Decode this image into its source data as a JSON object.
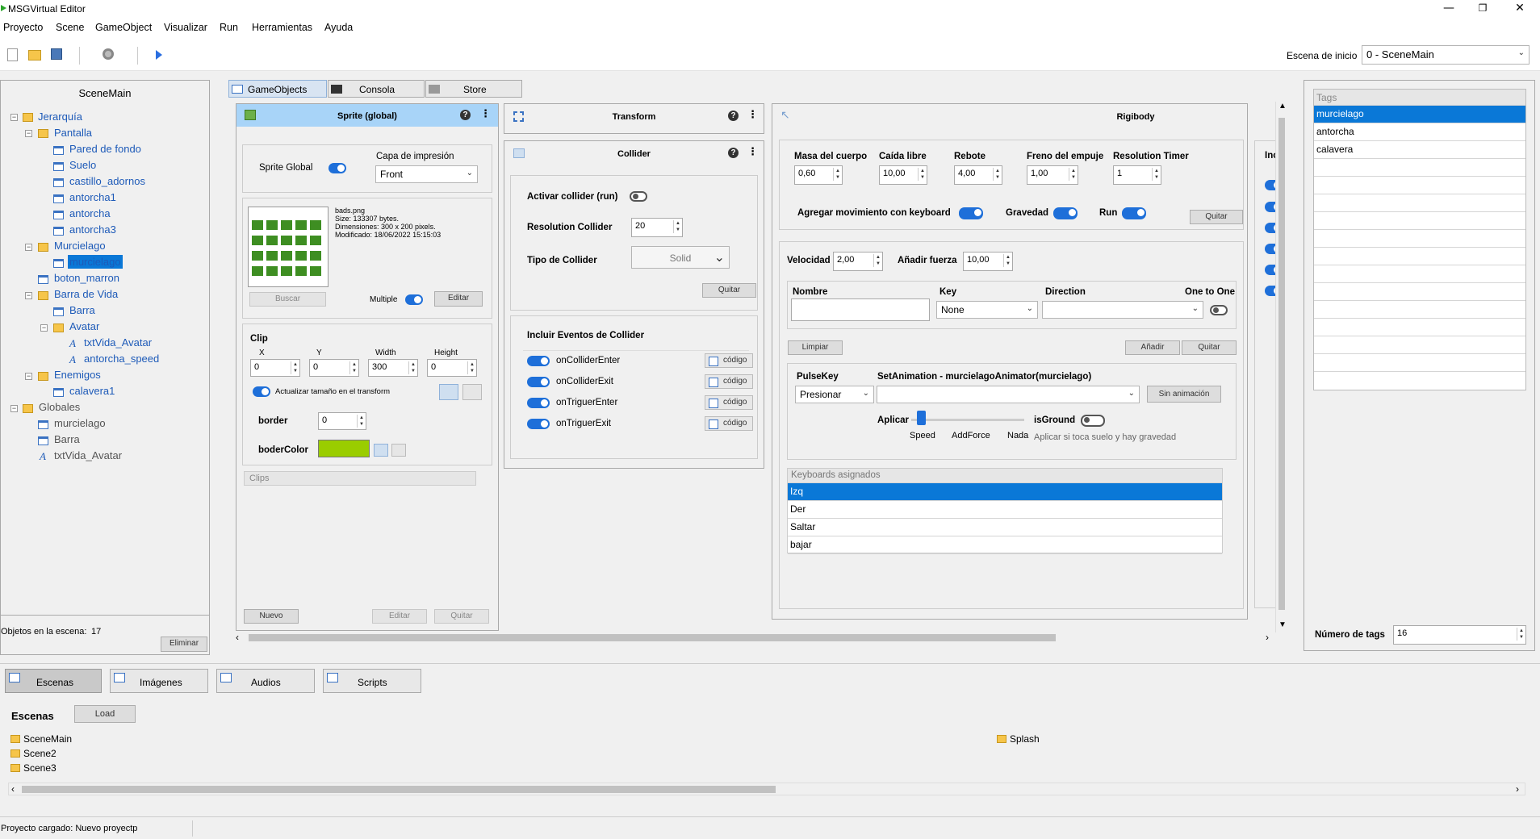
{
  "window": {
    "title": "MSGVirtual Editor",
    "minimize": "—",
    "maximize": "❐",
    "close": "✕"
  },
  "menu": [
    "Proyecto",
    "Scene",
    "GameObject",
    "Visualizar",
    "Run",
    "Herramientas",
    "Ayuda"
  ],
  "toolbar": {
    "start_scene_label": "Escena de inicio",
    "start_scene_value": "0 - SceneMain"
  },
  "hierarchy": {
    "title": "SceneMain",
    "nodes": [
      "Jerarquía",
      "Pantalla",
      "Pared de fondo",
      "Suelo",
      "castillo_adornos",
      "antorcha1",
      "antorcha",
      "antorcha3",
      "Murcielago",
      "murcielago",
      "boton_marron",
      "Barra de Vida",
      "Barra",
      "Avatar",
      "txtVida_Avatar",
      "antorcha_speed",
      "Enemigos",
      "calavera1",
      "Globales",
      "murcielago",
      "Barra",
      "txtVida_Avatar"
    ],
    "count_label": "Objetos en la escena:",
    "count": "17",
    "delete_button": "Eliminar"
  },
  "inspector_tabs": [
    "GameObjects",
    "Consola",
    "Store"
  ],
  "sprite": {
    "title": "Sprite (global)",
    "global_label": "Sprite Global",
    "layer_label": "Capa de impresión",
    "layer_value": "Front",
    "file_name": "bads.png",
    "file_size": "Size: 133307 bytes.",
    "file_dims": "Dimensiones: 300 x 200 pixels.",
    "file_modified": "Modificado: 18/06/2022 15:15:03",
    "search_button": "Buscar",
    "multiple_label": "Multiple",
    "edit_button": "Editar",
    "clip_label": "Clip",
    "clip_fields": [
      {
        "label": "X",
        "value": "0"
      },
      {
        "label": "Y",
        "value": "0"
      },
      {
        "label": "Width",
        "value": "300"
      },
      {
        "label": "Height",
        "value": "0"
      }
    ],
    "update_size_label": "Actualizar tamaño en el transform",
    "border_label": "border",
    "border_value": "0",
    "border_color_label": "boderColor",
    "border_color": "#9acd00",
    "clips_label": "Clips",
    "new_button": "Nuevo",
    "edit2_button": "Editar",
    "remove_button": "Quitar"
  },
  "transform": {
    "title": "Transform"
  },
  "collider": {
    "title": "Collider",
    "activate_label": "Activar collider (run)",
    "resolution_label": "Resolution Collider",
    "resolution_value": "20",
    "type_label": "Tipo de Collider",
    "type_value": "Solid",
    "remove_button": "Quitar",
    "events_title": "Incluir Eventos de Collider",
    "events": [
      "onColliderEnter",
      "onColliderExit",
      "onTriguerEnter",
      "onTriguerExit"
    ],
    "code_button": "código"
  },
  "rigidbody": {
    "title": "Rigibody",
    "fields": [
      {
        "label": "Masa del cuerpo",
        "value": "0,60"
      },
      {
        "label": "Caída libre",
        "value": "10,00"
      },
      {
        "label": "Rebote",
        "value": "4,00"
      },
      {
        "label": "Freno del empuje",
        "value": "1,00"
      },
      {
        "label": "Resolution Timer",
        "value": "1"
      }
    ],
    "keyboard_move_label": "Agregar movimiento con keyboard",
    "gravity_label": "Gravedad",
    "run_label": "Run",
    "remove_button": "Quitar",
    "speed_label": "Velocidad",
    "speed_value": "2,00",
    "force_label": "Añadir fuerza",
    "force_value": "10,00",
    "name_label": "Nombre",
    "key_label": "Key",
    "key_value": "None",
    "direction_label": "Direction",
    "one_to_one_label": "One to One",
    "clear_button": "Limpiar",
    "add_button": "Añadir",
    "remove2_button": "Quitar",
    "pulsekey_label": "PulseKey",
    "pulsekey_value": "Presionar",
    "set_animation_label": "SetAnimation - murcielagoAnimator(murcielago)",
    "no_animation_button": "Sin animación",
    "apply_label": "Aplicar",
    "apply_options": [
      "Speed",
      "AddForce",
      "Nada"
    ],
    "is_ground_label": "isGround",
    "is_ground_hint": "Aplicar si toca suelo y hay gravedad",
    "assigned_title": "Keyboards asignados",
    "assigned": [
      "Izq",
      "Der",
      "Saltar",
      "bajar"
    ],
    "partial_label": "Inc"
  },
  "tags": {
    "title": "Tags",
    "items": [
      "murcielago",
      "antorcha",
      "calavera"
    ],
    "count_label": "Número de tags",
    "count_value": "16"
  },
  "bottom": {
    "tabs": [
      "Escenas",
      "Imágenes",
      "Audios",
      "Scripts"
    ],
    "scenes_label": "Escenas",
    "load_button": "Load",
    "scenes": [
      "SceneMain",
      "Scene2",
      "Scene3",
      "Splash"
    ]
  },
  "status": "Proyecto cargado: Nuevo proyectp"
}
